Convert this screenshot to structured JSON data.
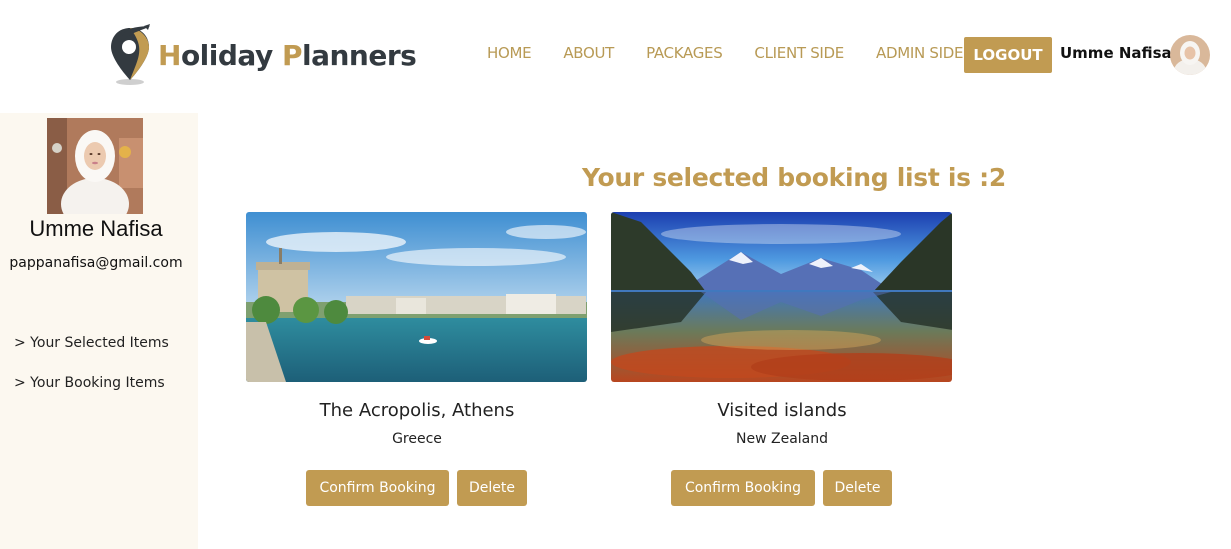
{
  "brand": {
    "letter1": "H",
    "part1": "oliday ",
    "letter2": "P",
    "part2": "lanners"
  },
  "nav": {
    "links": [
      "HOME",
      "ABOUT",
      "PACKAGES",
      "CLIENT SIDE",
      "ADMIN SIDE"
    ],
    "logout_label": "LOGOUT",
    "user_name": "Umme Nafisa"
  },
  "sidebar": {
    "name": "Umme Nafisa",
    "email": "pappanafisa@gmail.com",
    "items": [
      "> Your Selected Items",
      "> Your Booking Items"
    ]
  },
  "main": {
    "heading": "Your selected booking list is :2",
    "cards": [
      {
        "title": "The Acropolis, Athens",
        "location": "Greece",
        "confirm_label": "Confirm Booking",
        "delete_label": "Delete"
      },
      {
        "title": "Visited islands",
        "location": "New Zealand",
        "confirm_label": "Confirm Booking",
        "delete_label": "Delete"
      }
    ]
  },
  "colors": {
    "accent": "#c19b52",
    "sidebar_bg": "#fcf8f0",
    "dark": "#333a40"
  }
}
